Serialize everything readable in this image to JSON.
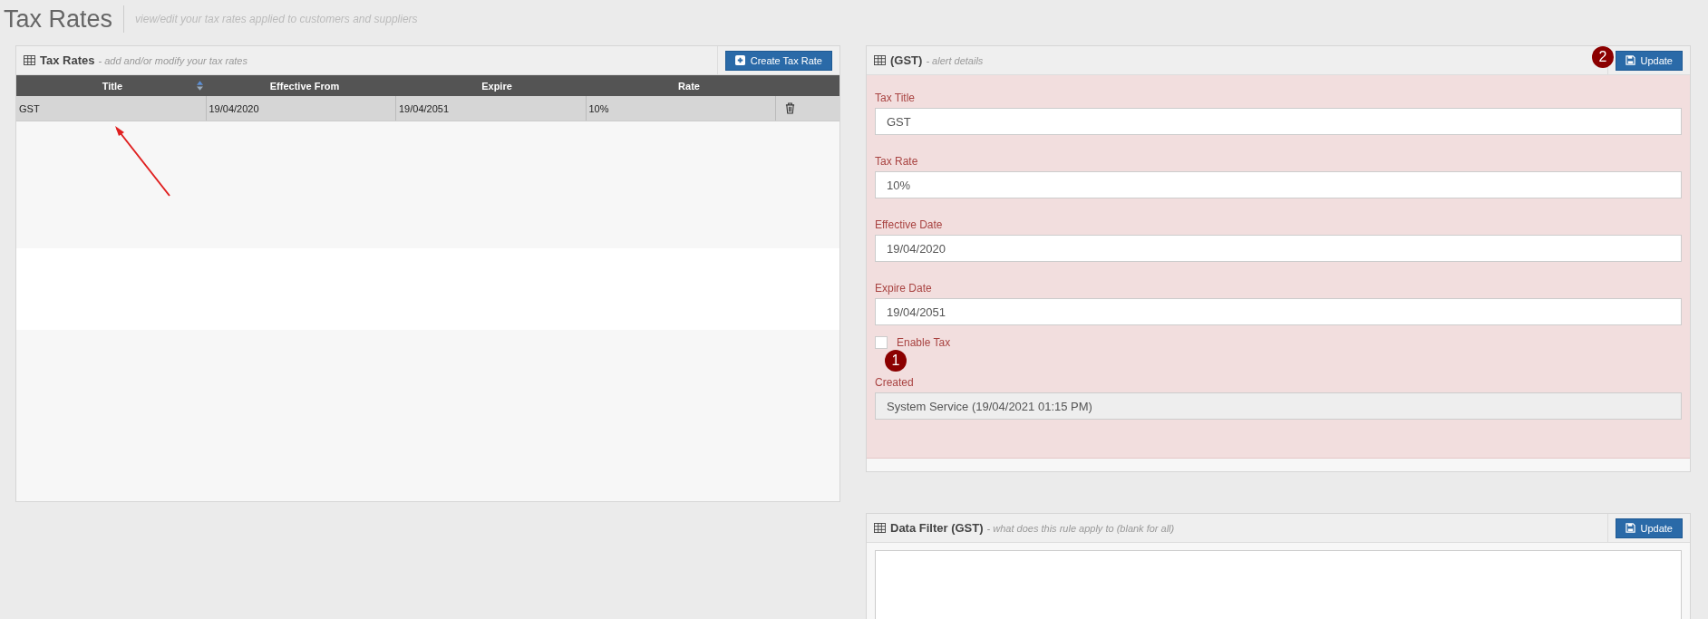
{
  "page": {
    "title": "Tax Rates",
    "subtitle": "view/edit your tax rates applied to customers and suppliers"
  },
  "tax_rates_panel": {
    "title": "Tax Rates",
    "subtitle": "- add and/or modify your tax rates",
    "button": "Create Tax Rate",
    "table": {
      "columns": [
        {
          "label": "Title",
          "sortable": true
        },
        {
          "label": "Effective From",
          "sortable": false
        },
        {
          "label": "Expire",
          "sortable": false
        },
        {
          "label": "Rate",
          "sortable": false
        }
      ],
      "rows": [
        {
          "cells": [
            "GST",
            "19/04/2020",
            "19/04/2051",
            "10%"
          ],
          "selected": true
        }
      ]
    }
  },
  "details_panel": {
    "title": "(GST)",
    "subtitle": "- alert details",
    "button": "Update",
    "fields": [
      {
        "kind": "text",
        "label": "Tax Title",
        "value": "GST",
        "disabled": false
      },
      {
        "kind": "text",
        "label": "Tax Rate",
        "value": "10%",
        "disabled": false
      },
      {
        "kind": "text",
        "label": "Effective Date",
        "value": "19/04/2020",
        "disabled": false
      },
      {
        "kind": "text",
        "label": "Expire Date",
        "value": "19/04/2051",
        "disabled": false
      },
      {
        "kind": "checkbox",
        "label": "Enable Tax",
        "checked": false
      },
      {
        "kind": "text",
        "label": "Created",
        "value": "System Service (19/04/2021 01:15 PM)",
        "disabled": true
      }
    ]
  },
  "data_filter_panel": {
    "title": "Data Filter (GST)",
    "subtitle": "- what does this rule apply to (blank for all)",
    "button": "Update"
  },
  "annotations": [
    {
      "kind": "badge",
      "text": "1"
    },
    {
      "kind": "badge",
      "text": "2"
    },
    {
      "kind": "arrow"
    }
  ]
}
